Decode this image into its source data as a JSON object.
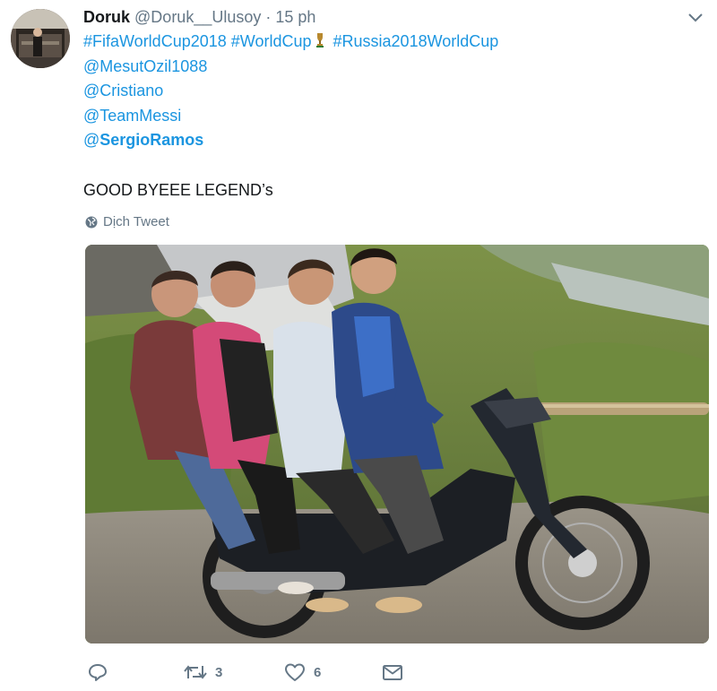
{
  "tweet": {
    "display_name": "Doruk",
    "handle": "@Doruk__Ulusoy",
    "separator": "·",
    "time": "15 ph",
    "hashtags": {
      "tag1": "#FifaWorldCup2018",
      "tag2": "#WorldCup",
      "tag3": "#Russia2018WorldCup"
    },
    "mentions": [
      "@MesutOzil1088",
      "@Cristiano",
      "@TeamMessi"
    ],
    "mention_bold_prefix": "@",
    "mention_bold_name": "SergioRamos",
    "text": "GOOD BYEEE LEGEND’s",
    "translate_label": "Dịch Tweet",
    "photo_icon": "four-men-on-motorbike-photo"
  },
  "actions": {
    "reply": {
      "icon": "reply-icon"
    },
    "retweet": {
      "icon": "retweet-icon",
      "count": "3"
    },
    "like": {
      "icon": "heart-icon",
      "count": "6"
    },
    "dm": {
      "icon": "envelope-icon"
    }
  },
  "colors": {
    "link": "#1b95e0",
    "muted": "#657786",
    "text": "#14171a"
  }
}
